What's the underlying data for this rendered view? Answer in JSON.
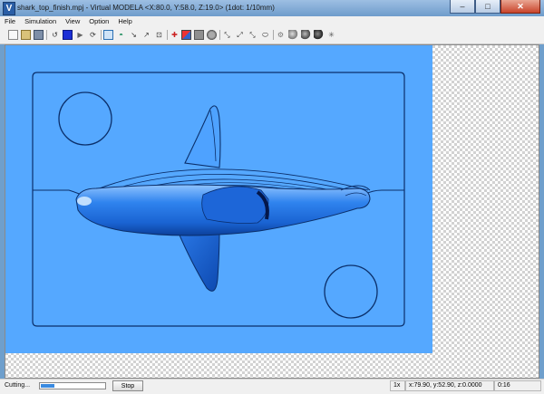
{
  "window": {
    "title": "shark_top_finish.mpj - Virtual MODELA <X:80.0, Y:58.0, Z:19.0> (1dot: 1/10mm)",
    "app_icon": "V",
    "caption": {
      "minimize": "–",
      "maximize": "□",
      "close": "✕"
    }
  },
  "menu": [
    "File",
    "Simulation",
    "View",
    "Option",
    "Help"
  ],
  "toolbar_icons": [
    "open-file-icon",
    "open-folder-icon",
    "save-icon",
    "rewind-icon",
    "stop-square-icon",
    "play-icon",
    "step-icon",
    "view-icon",
    "tool-icon",
    "path-icon",
    "curve-icon",
    "zoom-icon",
    "color-toggle-icon",
    "red-mode-icon",
    "flat-mode-icon",
    "sphere-icon",
    "view-a-icon",
    "view-b-icon",
    "view-c-icon",
    "view-d-icon",
    "gear-icon",
    "ball-icon",
    "ball-shaded-icon",
    "ball-dark-icon",
    "light-icon"
  ],
  "colors": {
    "material": "#55a8ff",
    "shark": "#1f6fe0",
    "accent": "#3a8ae0"
  },
  "status": {
    "state": "Cutting...",
    "progress": 0.22,
    "stop_label": "Stop",
    "zoom": "1x",
    "coords": "x:79.90, y:52.90, z:0.0000",
    "time": "0:16"
  }
}
